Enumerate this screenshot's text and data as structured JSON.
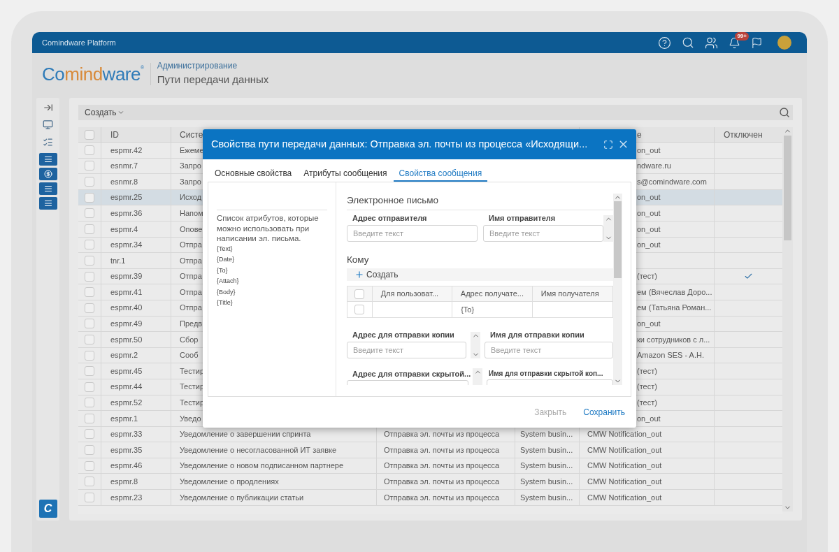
{
  "app_bar": {
    "title": "Comindware Platform",
    "notification_badge": "99+"
  },
  "logo": {
    "parts": [
      "Co",
      "mind",
      "ware"
    ],
    "mark": "®"
  },
  "breadcrumb": {
    "parent": "Администрирование",
    "title": "Пути передачи данных"
  },
  "sidebar": {
    "logo_letter": "C"
  },
  "toolbar": {
    "create": "Создать"
  },
  "table": {
    "select_all_checked": false,
    "columns": [
      "ID",
      "Систе",
      "e",
      "Отключен"
    ],
    "rows": [
      {
        "checked": false,
        "selected": false,
        "id": "espmr.42",
        "name": "Ежеме",
        "channel": "on_out",
        "disabled": false
      },
      {
        "checked": false,
        "selected": false,
        "id": "esnmr.7",
        "name": "Запро",
        "channel": "ndware.ru",
        "disabled": false
      },
      {
        "checked": false,
        "selected": false,
        "id": "esnmr.8",
        "name": "Запро",
        "channel": "s@comindware.com",
        "disabled": false
      },
      {
        "checked": false,
        "selected": true,
        "id": "espmr.25",
        "name": "Исход",
        "channel": "on_out",
        "disabled": false
      },
      {
        "checked": false,
        "selected": false,
        "id": "espmr.36",
        "name": "Напом",
        "channel": "on_out",
        "disabled": false
      },
      {
        "checked": false,
        "selected": false,
        "id": "espmr.4",
        "name": "Опове",
        "channel": "on_out",
        "disabled": false
      },
      {
        "checked": false,
        "selected": false,
        "id": "espmr.34",
        "name": "Отпра",
        "channel": "on_out",
        "disabled": false
      },
      {
        "checked": false,
        "selected": false,
        "id": "tnr.1",
        "name": "Отпра",
        "disabled": false
      },
      {
        "checked": false,
        "selected": false,
        "id": "espmr.39",
        "name": "Отпра",
        "channel": "(тест)",
        "disabled": true
      },
      {
        "checked": false,
        "selected": false,
        "id": "espmr.41",
        "name": "Отпра",
        "channel": "ем (Вячеслав Доро...",
        "disabled": false
      },
      {
        "checked": false,
        "selected": false,
        "id": "espmr.40",
        "name": "Отпра",
        "channel": "ем (Татьяна Роман...",
        "disabled": false
      },
      {
        "checked": false,
        "selected": false,
        "id": "espmr.49",
        "name": "Предв",
        "channel": "on_out",
        "disabled": false
      },
      {
        "checked": false,
        "selected": false,
        "id": "espmr.50",
        "name": "Сбор",
        "channel": "ки сотрудников с л...",
        "disabled": false
      },
      {
        "checked": false,
        "selected": false,
        "id": "espmr.2",
        "name": "Сооб",
        "channel": "Amazon SES - A.H.",
        "disabled": false
      },
      {
        "checked": false,
        "selected": false,
        "id": "espmr.45",
        "name": "Тестир",
        "channel": "(тест)",
        "disabled": false
      },
      {
        "checked": false,
        "selected": false,
        "id": "espmr.44",
        "name": "Тестир",
        "channel": "(тест)",
        "disabled": false
      },
      {
        "checked": false,
        "selected": false,
        "id": "espmr.52",
        "name": "Тестир",
        "channel": "(тест)",
        "disabled": false
      },
      {
        "checked": false,
        "selected": false,
        "id": "espmr.1",
        "name": "Уведо",
        "channel": "on_out",
        "disabled": false
      },
      {
        "checked": false,
        "selected": false,
        "id": "espmr.33",
        "name": "Уведомление о завершении спринта",
        "type": "Отправка эл. почты из процесса",
        "system": "System busin...",
        "channel": "CMW Notification_out",
        "disabled": false
      },
      {
        "checked": false,
        "selected": false,
        "id": "espmr.35",
        "name": "Уведомление о несогласованной ИТ заявке",
        "type": "Отправка эл. почты из процесса",
        "system": "System busin...",
        "channel": "CMW Notification_out",
        "disabled": false
      },
      {
        "checked": false,
        "selected": false,
        "id": "espmr.46",
        "name": "Уведомление о новом подписанном партнере",
        "type": "Отправка эл. почты из процесса",
        "system": "System busin...",
        "channel": "CMW Notification_out",
        "disabled": false
      },
      {
        "checked": false,
        "selected": false,
        "id": "espmr.8",
        "name": "Уведомление о продлениях",
        "type": "Отправка эл. почты из процесса",
        "system": "System busin...",
        "channel": "CMW Notification_out",
        "disabled": false
      },
      {
        "checked": false,
        "selected": false,
        "id": "espmr.23",
        "name": "Уведомление о публикации статьи",
        "type": "Отправка эл. почты из процесса",
        "system": "System busin...",
        "channel": "CMW Notification_out",
        "disabled": false
      }
    ]
  },
  "dialog": {
    "title": "Свойства пути передачи данных: Отправка эл. почты из процесса «Исходящи...",
    "tabs": [
      {
        "label": "Основные свойства",
        "selected": false
      },
      {
        "label": "Атрибуты сообщения",
        "selected": false
      },
      {
        "label": "Свойства сообщения",
        "selected": true
      }
    ],
    "hint": "Список атрибутов, которые можно использовать при написании эл. письма.",
    "attributes": [
      "{Text}",
      "{Date}",
      "{To}",
      "{Attach}",
      "{Body}",
      "{Title}"
    ],
    "section_email": "Электронное письмо",
    "sender_fields": [
      {
        "label": "Адрес отправителя",
        "placeholder": "Введите текст"
      },
      {
        "label": "Имя отправителя",
        "placeholder": "Введите текст"
      }
    ],
    "section_to": "Кому",
    "create": "Создать",
    "recipients": {
      "select_all_checked": false,
      "columns": [
        "Для пользоват...",
        "Адрес получате...",
        "Имя получателя"
      ],
      "rows": [
        {
          "checked": false,
          "cells": [
            "",
            "{To}",
            ""
          ]
        }
      ]
    },
    "copy_fields": [
      {
        "label": "Адрес для отправки копии",
        "placeholder": "Введите текст"
      },
      {
        "label": "Имя для отправки копии",
        "placeholder": "Введите текст"
      }
    ],
    "bcc_fields": [
      {
        "label": "Адрес для отправки скрытой..."
      },
      {
        "label": "Имя для отправки скрытой коп..."
      }
    ],
    "buttons": [
      {
        "label": "Закрыть",
        "disabled": true
      },
      {
        "label": "Сохранить",
        "disabled": false
      }
    ]
  }
}
